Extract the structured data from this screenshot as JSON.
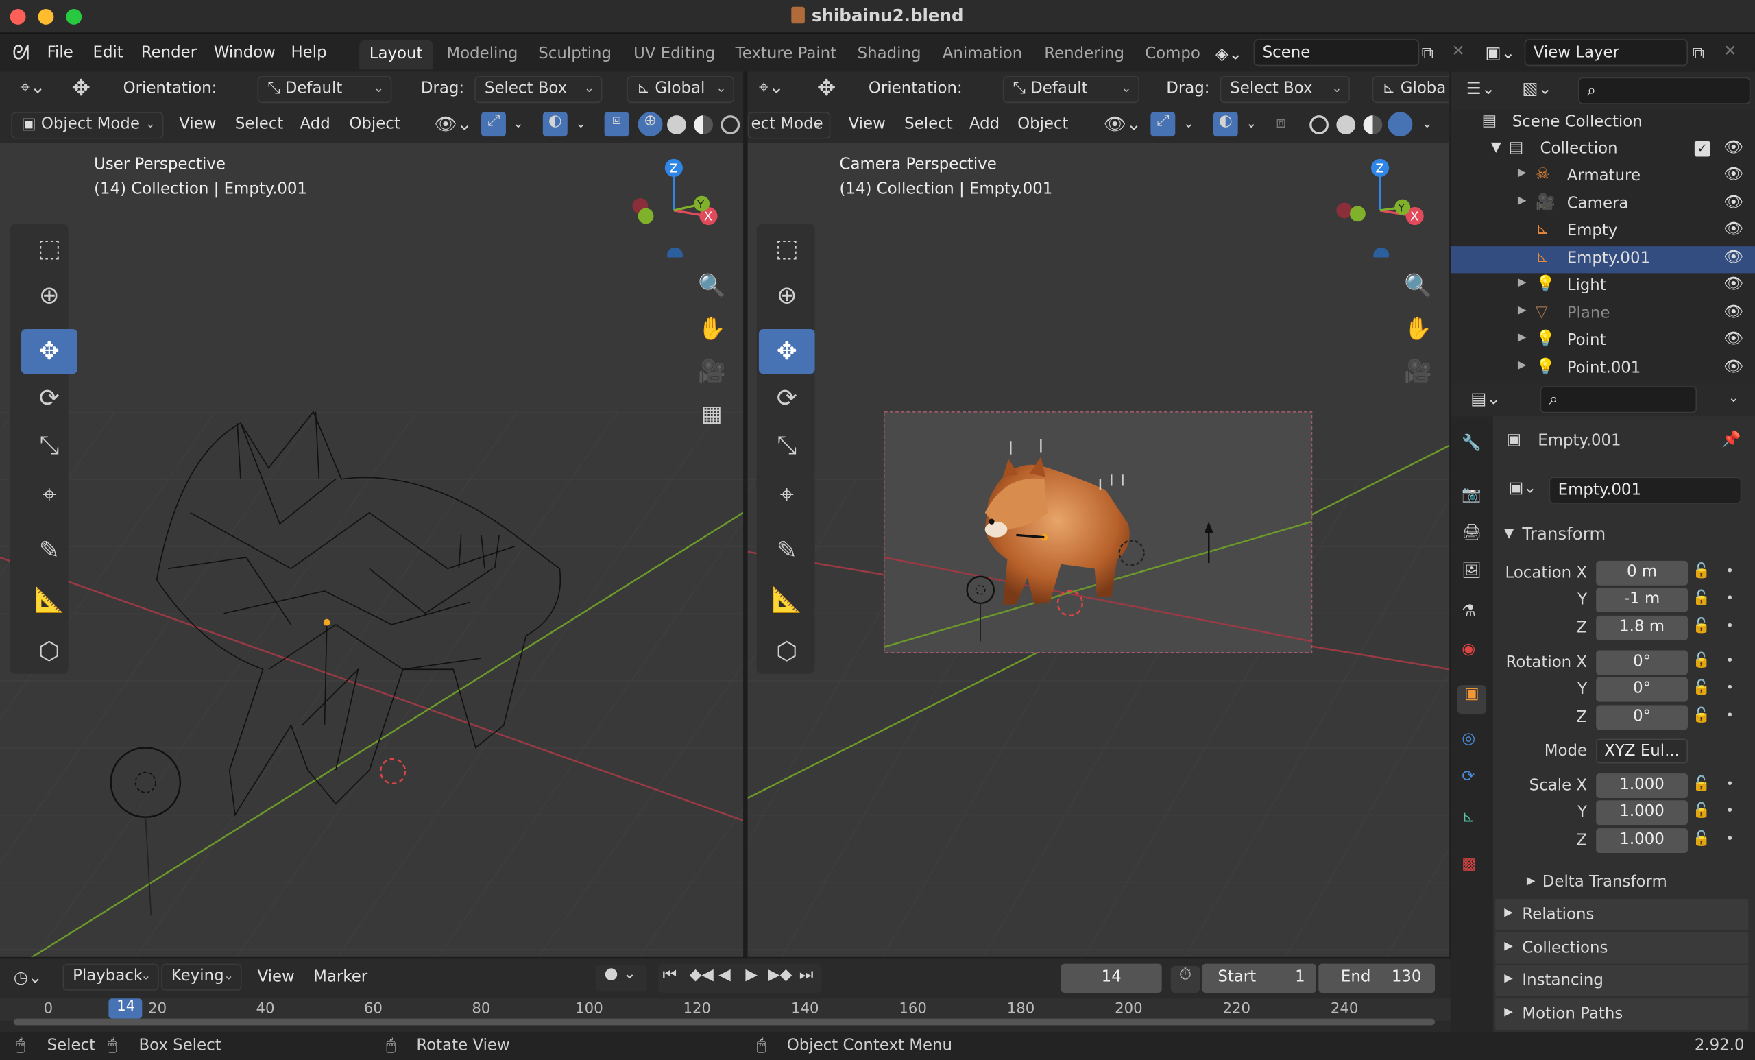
{
  "window": {
    "title": "shibainu2.blend",
    "file_icon": "blend-file-icon"
  },
  "menubar": {
    "items": [
      "File",
      "Edit",
      "Render",
      "Window",
      "Help"
    ],
    "workspaces": [
      "Layout",
      "Modeling",
      "Sculpting",
      "UV Editing",
      "Texture Paint",
      "Shading",
      "Animation",
      "Rendering",
      "Compo"
    ],
    "active_workspace": "Layout",
    "scene": "Scene",
    "view_layer": "View Layer"
  },
  "viewport_left": {
    "orientation_label": "Orientation:",
    "orientation_value": "Default",
    "drag_label": "Drag:",
    "drag_value": "Select Box",
    "transform_space": "Global",
    "mode": "Object Mode",
    "menus": [
      "View",
      "Select",
      "Add",
      "Object"
    ],
    "perspective": "User Perspective",
    "context": "(14) Collection | Empty.001"
  },
  "viewport_right": {
    "orientation_label": "Orientation:",
    "orientation_value": "Default",
    "drag_label": "Drag:",
    "drag_value": "Select Box",
    "transform_space": "Globa",
    "mode": "ect Mode",
    "menus": [
      "View",
      "Select",
      "Add",
      "Object"
    ],
    "perspective": "Camera Perspective",
    "context": "(14) Collection | Empty.001"
  },
  "gizmo": {
    "z": "Z",
    "y": "Y",
    "x": "X"
  },
  "outliner": {
    "root": "Scene Collection",
    "collection": "Collection",
    "items": [
      {
        "name": "Armature",
        "icon": "armature-icon"
      },
      {
        "name": "Camera",
        "icon": "camera-icon"
      },
      {
        "name": "Empty",
        "icon": "empty-icon"
      },
      {
        "name": "Empty.001",
        "icon": "empty-icon"
      },
      {
        "name": "Light",
        "icon": "light-icon"
      },
      {
        "name": "Plane",
        "icon": "mesh-icon"
      },
      {
        "name": "Point",
        "icon": "light-icon"
      },
      {
        "name": "Point.001",
        "icon": "light-icon"
      }
    ]
  },
  "properties": {
    "object_name": "Empty.001",
    "data_name": "Empty.001",
    "transform_title": "Transform",
    "location_label": "Location X",
    "location": [
      "0 m",
      "-1 m",
      "1.8 m"
    ],
    "rotation_label": "Rotation X",
    "rotation": [
      "0°",
      "0°",
      "0°"
    ],
    "mode_label": "Mode",
    "mode_value": "XYZ Eul...",
    "scale_label": "Scale X",
    "scale": [
      "1.000",
      "1.000",
      "1.000"
    ],
    "axis_y": "Y",
    "axis_z": "Z",
    "delta_transform": "Delta Transform",
    "panels": [
      "Relations",
      "Collections",
      "Instancing",
      "Motion Paths"
    ]
  },
  "timeline": {
    "menus": [
      "Playback",
      "Keying",
      "View",
      "Marker"
    ],
    "current_frame": "14",
    "start_label": "Start",
    "start": "1",
    "end_label": "End",
    "end": "130",
    "ticks": [
      "0",
      "20",
      "40",
      "60",
      "80",
      "100",
      "120",
      "140",
      "160",
      "180",
      "200",
      "220",
      "240"
    ]
  },
  "status": {
    "select": "Select",
    "box_select": "Box Select",
    "rotate_view": "Rotate View",
    "context_menu": "Object Context Menu",
    "version": "2.92.0"
  },
  "colors": {
    "accent": "#4772b3",
    "x_axis": "#e04a5a",
    "y_axis": "#7fb12a",
    "z_axis": "#2f86e6",
    "selection": "#334d80"
  }
}
